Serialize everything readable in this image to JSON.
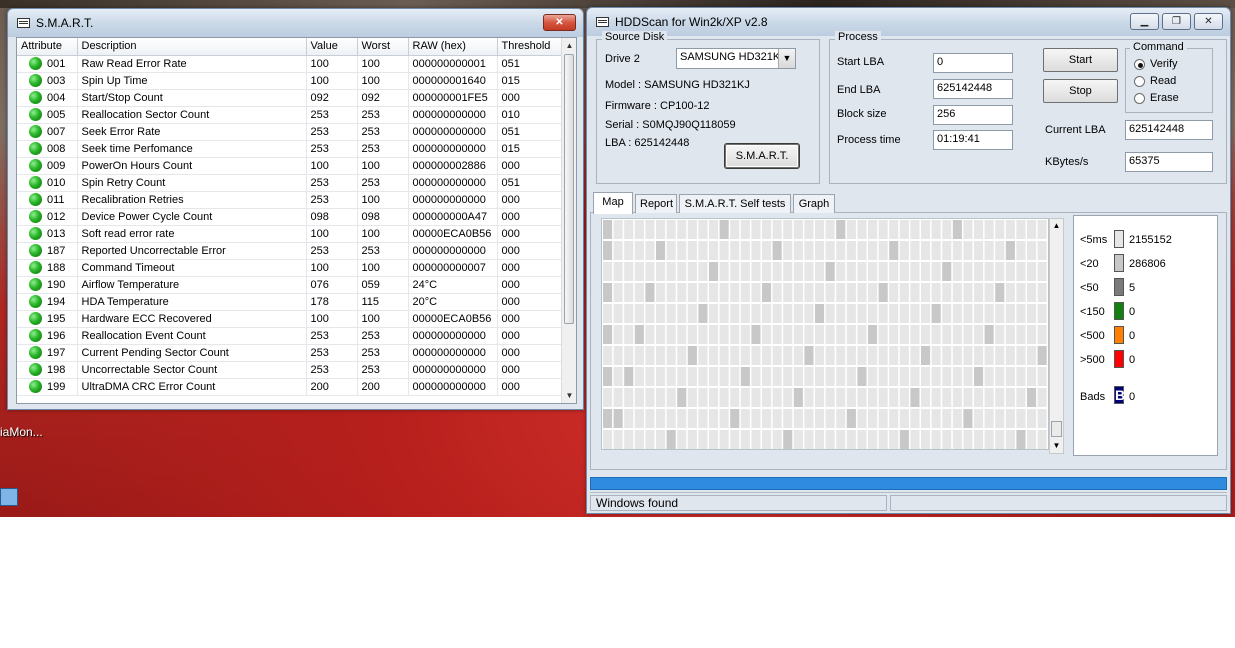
{
  "desktop": {
    "label": "iaMon..."
  },
  "smart": {
    "title": "S.M.A.R.T.",
    "columns": [
      "Attribute",
      "Description",
      "Value",
      "Worst",
      "RAW (hex)",
      "Threshold"
    ],
    "rows": [
      {
        "id": "001",
        "desc": "Raw Read Error Rate",
        "value": "100",
        "worst": "100",
        "raw": "000000000001",
        "threshold": "051"
      },
      {
        "id": "003",
        "desc": "Spin Up Time",
        "value": "100",
        "worst": "100",
        "raw": "000000001640",
        "threshold": "015"
      },
      {
        "id": "004",
        "desc": "Start/Stop Count",
        "value": "092",
        "worst": "092",
        "raw": "000000001FE5",
        "threshold": "000"
      },
      {
        "id": "005",
        "desc": "Reallocation Sector Count",
        "value": "253",
        "worst": "253",
        "raw": "000000000000",
        "threshold": "010"
      },
      {
        "id": "007",
        "desc": "Seek Error Rate",
        "value": "253",
        "worst": "253",
        "raw": "000000000000",
        "threshold": "051"
      },
      {
        "id": "008",
        "desc": "Seek time Perfomance",
        "value": "253",
        "worst": "253",
        "raw": "000000000000",
        "threshold": "015"
      },
      {
        "id": "009",
        "desc": "PowerOn Hours Count",
        "value": "100",
        "worst": "100",
        "raw": "000000002886",
        "threshold": "000"
      },
      {
        "id": "010",
        "desc": "Spin Retry Count",
        "value": "253",
        "worst": "253",
        "raw": "000000000000",
        "threshold": "051"
      },
      {
        "id": "011",
        "desc": "Recalibration Retries",
        "value": "253",
        "worst": "100",
        "raw": "000000000000",
        "threshold": "000"
      },
      {
        "id": "012",
        "desc": "Device Power Cycle Count",
        "value": "098",
        "worst": "098",
        "raw": "000000000A47",
        "threshold": "000"
      },
      {
        "id": "013",
        "desc": "Soft read error rate",
        "value": "100",
        "worst": "100",
        "raw": "00000ECA0B56",
        "threshold": "000"
      },
      {
        "id": "187",
        "desc": "Reported Uncorrectable Error",
        "value": "253",
        "worst": "253",
        "raw": "000000000000",
        "threshold": "000"
      },
      {
        "id": "188",
        "desc": "Command Timeout",
        "value": "100",
        "worst": "100",
        "raw": "000000000007",
        "threshold": "000"
      },
      {
        "id": "190",
        "desc": "Airflow Temperature",
        "value": "076",
        "worst": "059",
        "raw": "24°C",
        "threshold": "000"
      },
      {
        "id": "194",
        "desc": "HDA Temperature",
        "value": "178",
        "worst": "115",
        "raw": "20°C",
        "threshold": "000"
      },
      {
        "id": "195",
        "desc": "Hardware ECC Recovered",
        "value": "100",
        "worst": "100",
        "raw": "00000ECA0B56",
        "threshold": "000"
      },
      {
        "id": "196",
        "desc": "Reallocation Event Count",
        "value": "253",
        "worst": "253",
        "raw": "000000000000",
        "threshold": "000"
      },
      {
        "id": "197",
        "desc": "Current Pending Sector Count",
        "value": "253",
        "worst": "253",
        "raw": "000000000000",
        "threshold": "000"
      },
      {
        "id": "198",
        "desc": "Uncorrectable Sector Count",
        "value": "253",
        "worst": "253",
        "raw": "000000000000",
        "threshold": "000"
      },
      {
        "id": "199",
        "desc": "UltraDMA CRC Error Count",
        "value": "200",
        "worst": "200",
        "raw": "000000000000",
        "threshold": "000"
      }
    ]
  },
  "hdd": {
    "title": "HDDScan for Win2k/XP  v2.8",
    "source_disk": {
      "legend": "Source Disk",
      "drive_label": "Drive  2",
      "drive_value": "SAMSUNG HD321K",
      "model": "Model : SAMSUNG HD321KJ",
      "firmware": "Firmware : CP100-12",
      "serial": "Serial :  S0MQJ90Q118059",
      "lba": "LBA :   625142448",
      "smart_button": "S.M.A.R.T."
    },
    "process": {
      "legend": "Process",
      "start_lba_label": "Start LBA",
      "start_lba": "0",
      "end_lba_label": "End LBA",
      "end_lba": "625142448",
      "block_size_label": "Block size",
      "block_size": "256",
      "process_time_label": "Process time",
      "process_time": "01:19:41",
      "start_button": "Start",
      "stop_button": "Stop",
      "current_lba_label": "Current LBA",
      "current_lba": "625142448",
      "kbytes_label": "KBytes/s",
      "kbytes": "65375"
    },
    "command": {
      "legend": "Command",
      "options": [
        "Verify",
        "Read",
        "Erase"
      ],
      "selected": "Verify"
    },
    "tabs": [
      "Map",
      "Report",
      "S.M.A.R.T. Self tests",
      "Graph"
    ],
    "active_tab": "Map",
    "legend": [
      {
        "label": "<5ms",
        "value": "2155152",
        "color": "#e6e6e6"
      },
      {
        "label": "<20",
        "value": "286806",
        "color": "#c8c8c8"
      },
      {
        "label": "<50",
        "value": "5",
        "color": "#7a7a7a"
      },
      {
        "label": "<150",
        "value": "0",
        "color": "#108010"
      },
      {
        "label": "<500",
        "value": "0",
        "color": "#ff8000"
      },
      {
        "label": ">500",
        "value": "0",
        "color": "#ff0000"
      }
    ],
    "bads": {
      "label": "Bads",
      "value": "0",
      "glyph": "B",
      "color": "#00007a"
    },
    "progress_percent": 100,
    "status": "Windows  found"
  }
}
